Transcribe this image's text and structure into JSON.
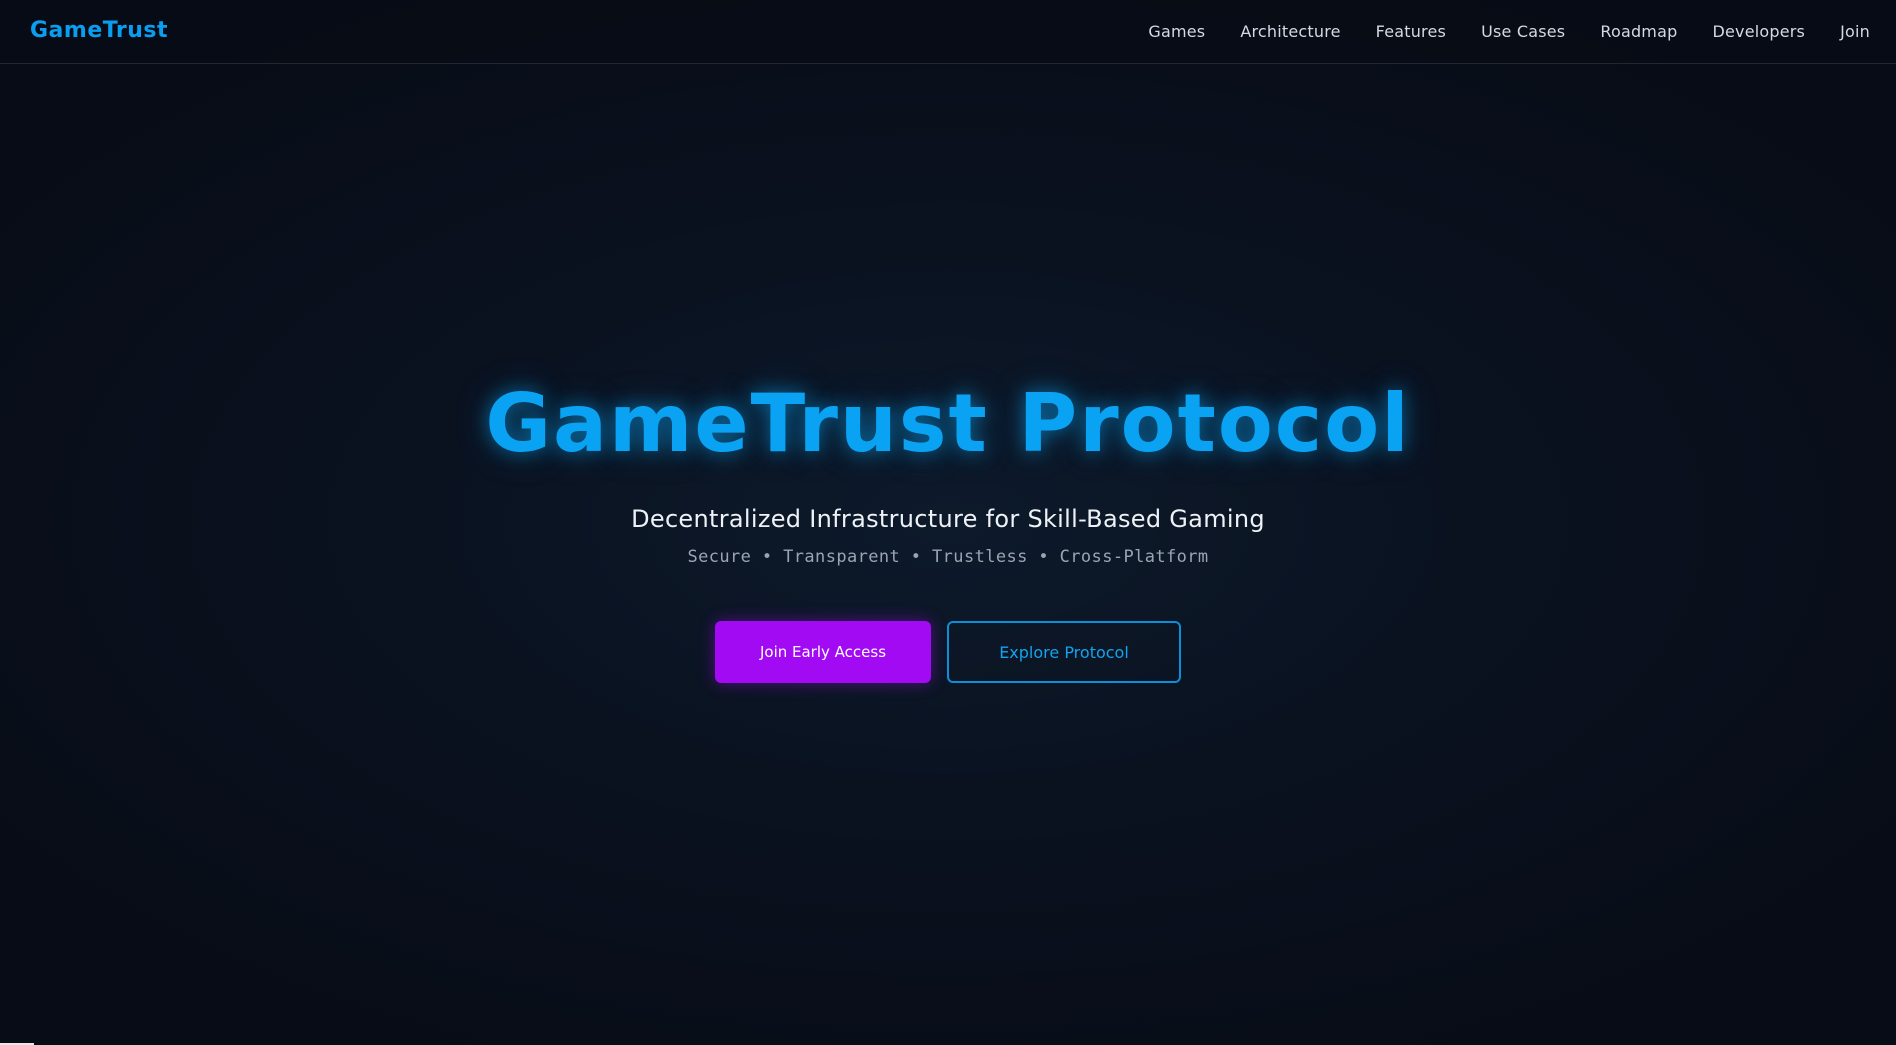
{
  "header": {
    "logo_text": "GameTrust",
    "nav_items": [
      {
        "label": "Games"
      },
      {
        "label": "Architecture"
      },
      {
        "label": "Features"
      },
      {
        "label": "Use Cases"
      },
      {
        "label": "Roadmap"
      },
      {
        "label": "Developers"
      },
      {
        "label": "Join"
      }
    ]
  },
  "hero": {
    "title": "GameTrust Protocol",
    "subtitle": "Decentralized Infrastructure for Skill-Based Gaming",
    "tagline": "Secure • Transparent • Trustless • Cross-Platform",
    "primary_button": "Join Early Access",
    "secondary_button": "Explore Protocol"
  },
  "colors": {
    "background": "#080c16",
    "accent_blue": "#0aa2f2",
    "accent_purple": "#a10af3",
    "nav_text": "#d4dae3"
  }
}
